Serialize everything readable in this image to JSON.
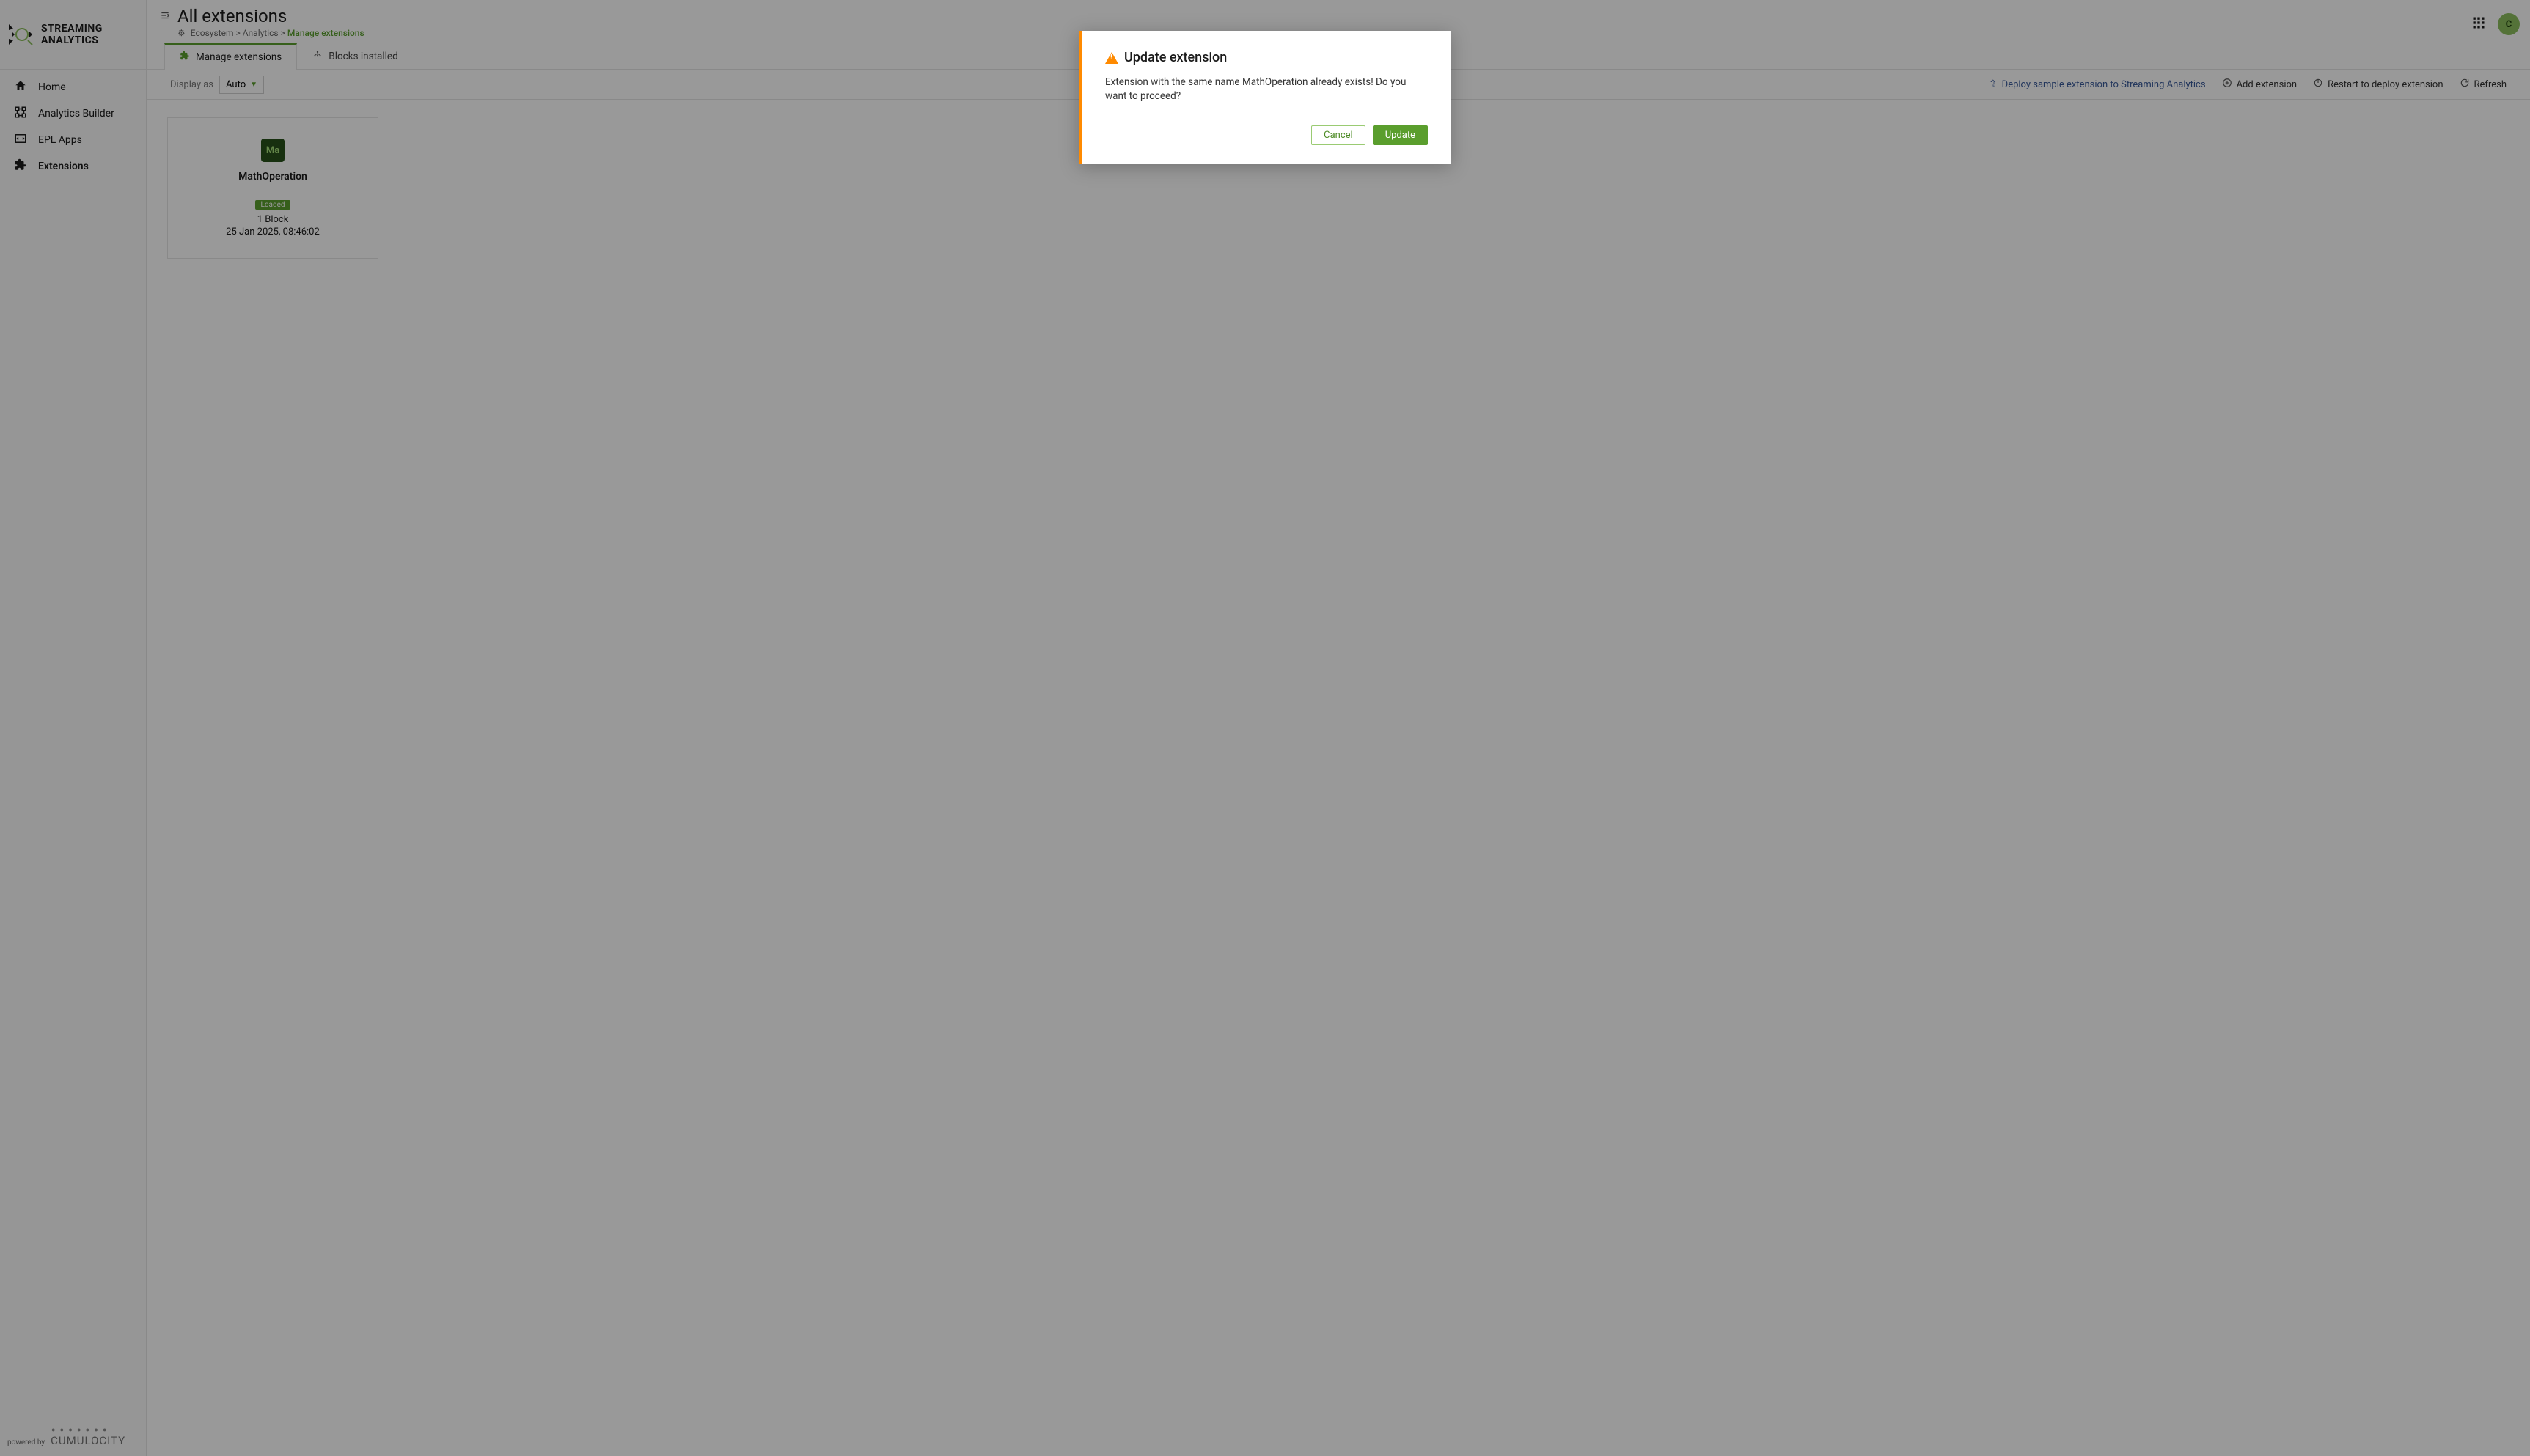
{
  "brand": {
    "line1": "STREAMING",
    "line2": "ANALYTICS"
  },
  "sidebar": {
    "items": [
      {
        "label": "Home"
      },
      {
        "label": "Analytics Builder"
      },
      {
        "label": "EPL Apps"
      },
      {
        "label": "Extensions"
      }
    ],
    "powered_by": "powered by",
    "footer_brand": "CUMULOCITY"
  },
  "header": {
    "title": "All extensions",
    "breadcrumb": {
      "crumb1": "Ecosystem",
      "crumb2": "Analytics",
      "crumb3": "Manage extensions",
      "sep": ">"
    },
    "avatar_initial": "C"
  },
  "tabs": {
    "manage": "Manage extensions",
    "blocks": "Blocks installed"
  },
  "toolbar": {
    "display_as_label": "Display as",
    "display_as_value": "Auto",
    "deploy_link": "Deploy sample extension to Streaming Analytics",
    "add": "Add extension",
    "restart": "Restart to deploy extension",
    "refresh": "Refresh"
  },
  "card": {
    "short": "Ma",
    "name": "MathOperation",
    "badge": "Loaded",
    "block_count": "1 Block",
    "timestamp": "25 Jan 2025, 08:46:02"
  },
  "dialog": {
    "title": "Update extension",
    "body": "Extension with the same name MathOperation already exists! Do you want to proceed?",
    "cancel": "Cancel",
    "update": "Update"
  }
}
